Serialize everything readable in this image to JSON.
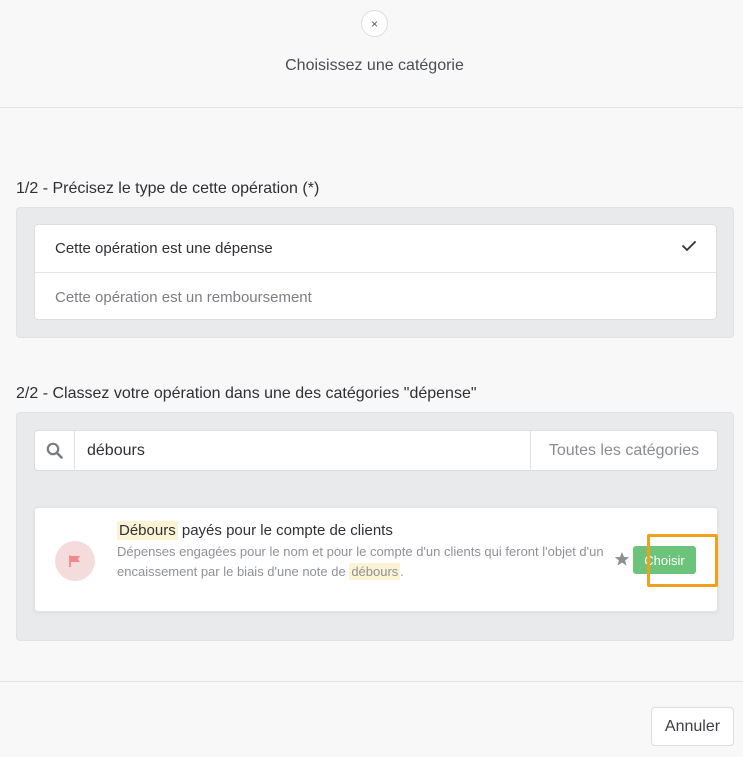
{
  "modal": {
    "close_label": "×",
    "title": "Choisissez une catégorie"
  },
  "step1": {
    "title": "1/2 - Précisez le type de cette opération (*)",
    "options": [
      {
        "label": "Cette opération est une dépense",
        "selected": true
      },
      {
        "label": "Cette opération est un remboursement",
        "selected": false
      }
    ]
  },
  "step2": {
    "title": "2/2 - Classez votre opération dans une des catégories \"dépense\"",
    "search": {
      "value": "débours",
      "icon": "search-icon"
    },
    "category_filter": "Toutes les catégories",
    "results": [
      {
        "icon": "flag-icon",
        "title_highlight": "Débours",
        "title_rest": " payés pour le compte de clients",
        "description_part1": "Dépenses engagées pour le nom et pour le compte d'un clients qui feront l'objet d'un encaissement par le biais d'une note de ",
        "description_highlight": "débours",
        "description_end": ".",
        "choose_label": "Choisir"
      }
    ]
  },
  "footer": {
    "cancel_label": "Annuler"
  },
  "colors": {
    "accent_green": "#6cc47b",
    "highlight_orange": "#f0a11c",
    "flag_red": "#f08a8a"
  }
}
